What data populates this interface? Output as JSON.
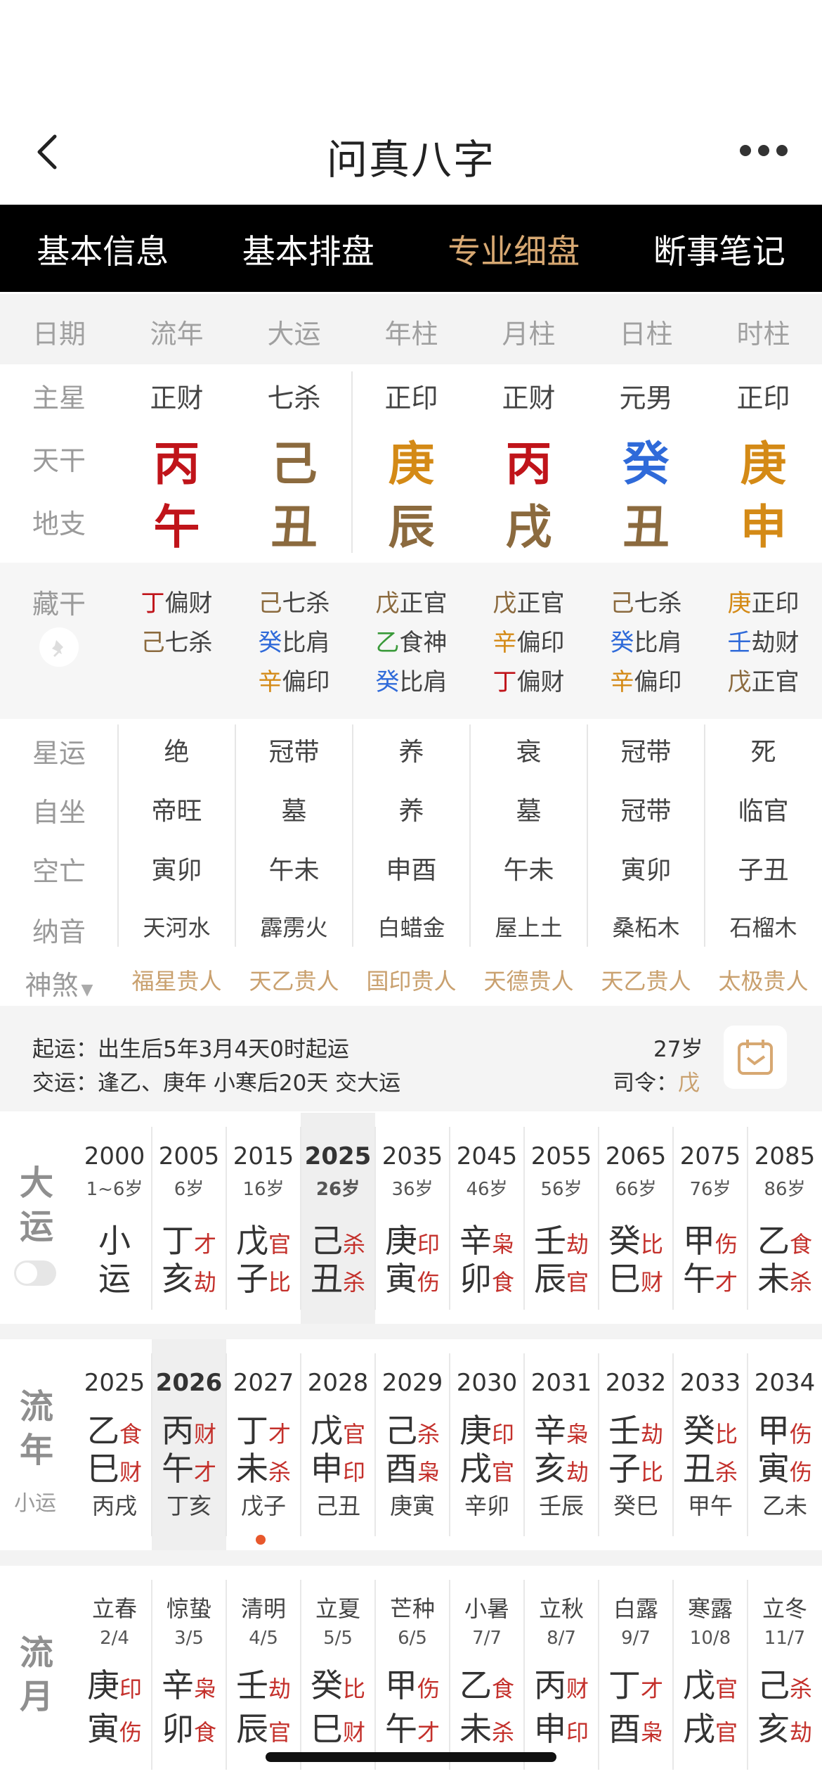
{
  "header": {
    "title": "问真八字",
    "back_icon": "chevron-left-icon",
    "more_icon": "more-dots-icon"
  },
  "tabs": [
    {
      "label": "基本信息",
      "active": false
    },
    {
      "label": "基本排盘",
      "active": false
    },
    {
      "label": "专业细盘",
      "active": true
    },
    {
      "label": "断事笔记",
      "active": false
    }
  ],
  "columns": [
    "日期",
    "流年",
    "大运",
    "年柱",
    "月柱",
    "日柱",
    "时柱"
  ],
  "row_labels": {
    "zhuxing": "主星",
    "tiangan": "天干",
    "dizhi": "地支",
    "canggan": "藏干",
    "xingyun": "星运",
    "zizuo": "自坐",
    "kongwang": "空亡",
    "nayin": "纳音",
    "shensha": "神煞"
  },
  "zhuxing": [
    "正财",
    "七杀",
    "正印",
    "正财",
    "元男",
    "正印"
  ],
  "tiangan": [
    {
      "c": "丙",
      "color": "#c0141a"
    },
    {
      "c": "己",
      "color": "#8b6a3e"
    },
    {
      "c": "庚",
      "color": "#d48a16"
    },
    {
      "c": "丙",
      "color": "#c0141a"
    },
    {
      "c": "癸",
      "color": "#2f6ad9"
    },
    {
      "c": "庚",
      "color": "#d48a16"
    }
  ],
  "dizhi": [
    {
      "c": "午",
      "color": "#c0141a"
    },
    {
      "c": "丑",
      "color": "#8b6a3e"
    },
    {
      "c": "辰",
      "color": "#8b6a3e"
    },
    {
      "c": "戌",
      "color": "#8b6a3e"
    },
    {
      "c": "丑",
      "color": "#8b6a3e"
    },
    {
      "c": "申",
      "color": "#d48a16"
    }
  ],
  "canggan": [
    [
      {
        "g": "丁",
        "gc": "#c0141a",
        "s": "偏财"
      },
      {
        "g": "己",
        "gc": "#8b6a3e",
        "s": "七杀"
      }
    ],
    [
      {
        "g": "己",
        "gc": "#8b6a3e",
        "s": "七杀"
      },
      {
        "g": "癸",
        "gc": "#2f6ad9",
        "s": "比肩"
      },
      {
        "g": "辛",
        "gc": "#d48a16",
        "s": "偏印"
      }
    ],
    [
      {
        "g": "戊",
        "gc": "#8b6a3e",
        "s": "正官"
      },
      {
        "g": "乙",
        "gc": "#3a9a3a",
        "s": "食神"
      },
      {
        "g": "癸",
        "gc": "#2f6ad9",
        "s": "比肩"
      }
    ],
    [
      {
        "g": "戊",
        "gc": "#8b6a3e",
        "s": "正官"
      },
      {
        "g": "辛",
        "gc": "#d48a16",
        "s": "偏印"
      },
      {
        "g": "丁",
        "gc": "#c0141a",
        "s": "偏财"
      }
    ],
    [
      {
        "g": "己",
        "gc": "#8b6a3e",
        "s": "七杀"
      },
      {
        "g": "癸",
        "gc": "#2f6ad9",
        "s": "比肩"
      },
      {
        "g": "辛",
        "gc": "#d48a16",
        "s": "偏印"
      }
    ],
    [
      {
        "g": "庚",
        "gc": "#d48a16",
        "s": "正印"
      },
      {
        "g": "壬",
        "gc": "#2f6ad9",
        "s": "劫财"
      },
      {
        "g": "戊",
        "gc": "#8b6a3e",
        "s": "正官"
      }
    ]
  ],
  "xingyun": [
    "绝",
    "冠带",
    "养",
    "衰",
    "冠带",
    "死"
  ],
  "zizuo": [
    "帝旺",
    "墓",
    "养",
    "墓",
    "冠带",
    "临官"
  ],
  "kongwang": [
    "寅卯",
    "午未",
    "申酉",
    "午未",
    "寅卯",
    "子丑"
  ],
  "nayin": [
    "天河水",
    "霹雳火",
    "白蜡金",
    "屋上土",
    "桑柘木",
    "石榴木"
  ],
  "shensha": [
    "福星贵人",
    "天乙贵人",
    "国印贵人",
    "天德贵人",
    "天乙贵人",
    "太极贵人"
  ],
  "qiyun": {
    "line1_label": "起运：",
    "line1_text": "出生后5年3月4天0时起运",
    "line2_label": "交运：",
    "line2_text": "逢乙、庚年 小寒后20天 交大运",
    "age": "27岁",
    "siling_label": "司令：",
    "siling_value": "戊",
    "calendar_icon": "calendar-icon"
  },
  "dayun": {
    "label": [
      "大",
      "运"
    ],
    "items": [
      {
        "year": "2000",
        "age": "1~6岁",
        "g": "小",
        "gs": "",
        "z": "运",
        "zs": "",
        "hl": false
      },
      {
        "year": "2005",
        "age": "6岁",
        "g": "丁",
        "gs": "才",
        "z": "亥",
        "zs": "劫",
        "hl": false
      },
      {
        "year": "2015",
        "age": "16岁",
        "g": "戊",
        "gs": "官",
        "z": "子",
        "zs": "比",
        "hl": false
      },
      {
        "year": "2025",
        "age": "26岁",
        "g": "己",
        "gs": "杀",
        "z": "丑",
        "zs": "杀",
        "hl": true
      },
      {
        "year": "2035",
        "age": "36岁",
        "g": "庚",
        "gs": "印",
        "z": "寅",
        "zs": "伤",
        "hl": false
      },
      {
        "year": "2045",
        "age": "46岁",
        "g": "辛",
        "gs": "枭",
        "z": "卯",
        "zs": "食",
        "hl": false
      },
      {
        "year": "2055",
        "age": "56岁",
        "g": "壬",
        "gs": "劫",
        "z": "辰",
        "zs": "官",
        "hl": false
      },
      {
        "year": "2065",
        "age": "66岁",
        "g": "癸",
        "gs": "比",
        "z": "巳",
        "zs": "财",
        "hl": false
      },
      {
        "year": "2075",
        "age": "76岁",
        "g": "甲",
        "gs": "伤",
        "z": "午",
        "zs": "才",
        "hl": false
      },
      {
        "year": "2085",
        "age": "86岁",
        "g": "乙",
        "gs": "食",
        "z": "未",
        "zs": "杀",
        "hl": false
      }
    ]
  },
  "liunian": {
    "label": [
      "流",
      "年"
    ],
    "sublabel": "小运",
    "items": [
      {
        "year": "2025",
        "g": "乙",
        "gs": "食",
        "z": "巳",
        "zs": "财",
        "xy": "丙戌",
        "hl": false
      },
      {
        "year": "2026",
        "g": "丙",
        "gs": "财",
        "z": "午",
        "zs": "才",
        "xy": "丁亥",
        "hl": true
      },
      {
        "year": "2027",
        "g": "丁",
        "gs": "才",
        "z": "未",
        "zs": "杀",
        "xy": "戊子",
        "hl": false
      },
      {
        "year": "2028",
        "g": "戊",
        "gs": "官",
        "z": "申",
        "zs": "印",
        "xy": "己丑",
        "hl": false
      },
      {
        "year": "2029",
        "g": "己",
        "gs": "杀",
        "z": "酉",
        "zs": "枭",
        "xy": "庚寅",
        "hl": false
      },
      {
        "year": "2030",
        "g": "庚",
        "gs": "印",
        "z": "戌",
        "zs": "官",
        "xy": "辛卯",
        "hl": false
      },
      {
        "year": "2031",
        "g": "辛",
        "gs": "枭",
        "z": "亥",
        "zs": "劫",
        "xy": "壬辰",
        "hl": false
      },
      {
        "year": "2032",
        "g": "壬",
        "gs": "劫",
        "z": "子",
        "zs": "比",
        "xy": "癸巳",
        "hl": false
      },
      {
        "year": "2033",
        "g": "癸",
        "gs": "比",
        "z": "丑",
        "zs": "杀",
        "xy": "甲午",
        "hl": false
      },
      {
        "year": "2034",
        "g": "甲",
        "gs": "伤",
        "z": "寅",
        "zs": "伤",
        "xy": "乙未",
        "hl": false
      }
    ]
  },
  "liuyue": {
    "label": [
      "流",
      "月"
    ],
    "items": [
      {
        "jq": "立春",
        "date": "2/4",
        "g": "庚",
        "gs": "印",
        "z": "寅",
        "zs": "伤"
      },
      {
        "jq": "惊蛰",
        "date": "3/5",
        "g": "辛",
        "gs": "枭",
        "z": "卯",
        "zs": "食"
      },
      {
        "jq": "清明",
        "date": "4/5",
        "g": "壬",
        "gs": "劫",
        "z": "辰",
        "zs": "官"
      },
      {
        "jq": "立夏",
        "date": "5/5",
        "g": "癸",
        "gs": "比",
        "z": "巳",
        "zs": "财"
      },
      {
        "jq": "芒种",
        "date": "6/5",
        "g": "甲",
        "gs": "伤",
        "z": "午",
        "zs": "才"
      },
      {
        "jq": "小暑",
        "date": "7/7",
        "g": "乙",
        "gs": "食",
        "z": "未",
        "zs": "杀"
      },
      {
        "jq": "立秋",
        "date": "8/7",
        "g": "丙",
        "gs": "财",
        "z": "申",
        "zs": "印"
      },
      {
        "jq": "白露",
        "date": "9/7",
        "g": "丁",
        "gs": "才",
        "z": "酉",
        "zs": "枭"
      },
      {
        "jq": "寒露",
        "date": "10/8",
        "g": "戊",
        "gs": "官",
        "z": "戌",
        "zs": "官"
      },
      {
        "jq": "立冬",
        "date": "11/7",
        "g": "己",
        "gs": "杀",
        "z": "亥",
        "zs": "劫"
      }
    ]
  }
}
